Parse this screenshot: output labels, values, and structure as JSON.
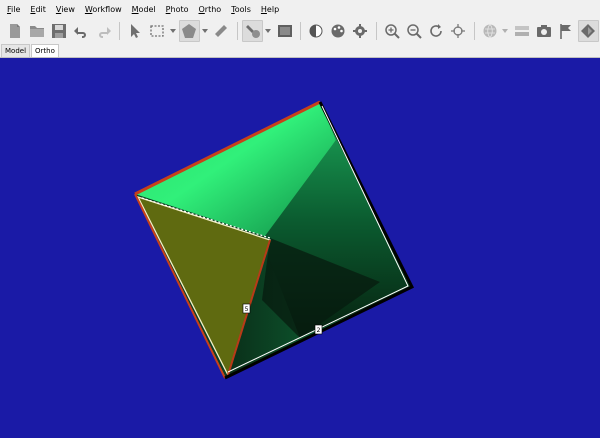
{
  "menu": [
    {
      "first": "F",
      "rest": "ile"
    },
    {
      "first": "E",
      "rest": "dit"
    },
    {
      "first": "V",
      "rest": "iew"
    },
    {
      "first": "W",
      "rest": "orkflow"
    },
    {
      "first": "M",
      "rest": "odel"
    },
    {
      "first": "P",
      "rest": "hoto"
    },
    {
      "first": "O",
      "rest": "rtho"
    },
    {
      "first": "T",
      "rest": "ools"
    },
    {
      "first": "H",
      "rest": "elp"
    }
  ],
  "tabs": [
    "Model",
    "Ortho"
  ],
  "active_tab": "Ortho",
  "viewport": {
    "background": "#1a1aa6",
    "markers": [
      "5",
      "2"
    ]
  }
}
